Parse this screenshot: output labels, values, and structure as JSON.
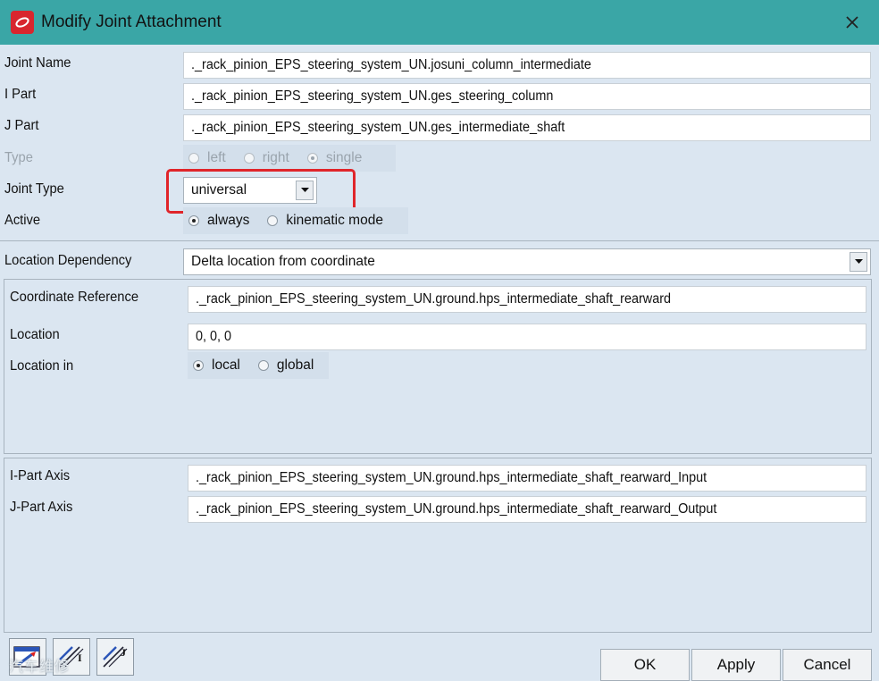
{
  "window": {
    "title": "Modify Joint Attachment",
    "close_glyph": "✕"
  },
  "fields": {
    "joint_name": {
      "label": "Joint Name",
      "value": "._rack_pinion_EPS_steering_system_UN.josuni_column_intermediate"
    },
    "i_part": {
      "label": "I Part",
      "value": "._rack_pinion_EPS_steering_system_UN.ges_steering_column"
    },
    "j_part": {
      "label": "J Part",
      "value": "._rack_pinion_EPS_steering_system_UN.ges_intermediate_shaft"
    }
  },
  "type": {
    "label": "Type",
    "options": [
      "left",
      "right",
      "single"
    ],
    "selected": "single"
  },
  "joint_type": {
    "label": "Joint Type",
    "value": "universal"
  },
  "active": {
    "label": "Active",
    "options": [
      "always",
      "kinematic mode"
    ],
    "selected": "always"
  },
  "location_dependency": {
    "label": "Location Dependency",
    "value": "Delta location from coordinate"
  },
  "coordinate_reference": {
    "label": "Coordinate Reference",
    "value": "._rack_pinion_EPS_steering_system_UN.ground.hps_intermediate_shaft_rearward"
  },
  "location": {
    "label": "Location",
    "value": "0, 0, 0"
  },
  "location_in": {
    "label": "Location in",
    "options": [
      "local",
      "global"
    ],
    "selected": "local"
  },
  "i_part_axis": {
    "label": "I-Part Axis",
    "value": "._rack_pinion_EPS_steering_system_UN.ground.hps_intermediate_shaft_rearward_Input"
  },
  "j_part_axis": {
    "label": "J-Part Axis",
    "value": "._rack_pinion_EPS_steering_system_UN.ground.hps_intermediate_shaft_rearward_Output"
  },
  "buttons": {
    "ok": "OK",
    "apply": "Apply",
    "cancel": "Cancel"
  },
  "toolbar": {
    "tool2_letter": "I",
    "tool3_letter": "J"
  },
  "watermark": "汽车维修",
  "colors": {
    "titlebar": "#3aa6a6",
    "highlight": "#e0252a",
    "app_icon": "#d8262e"
  }
}
